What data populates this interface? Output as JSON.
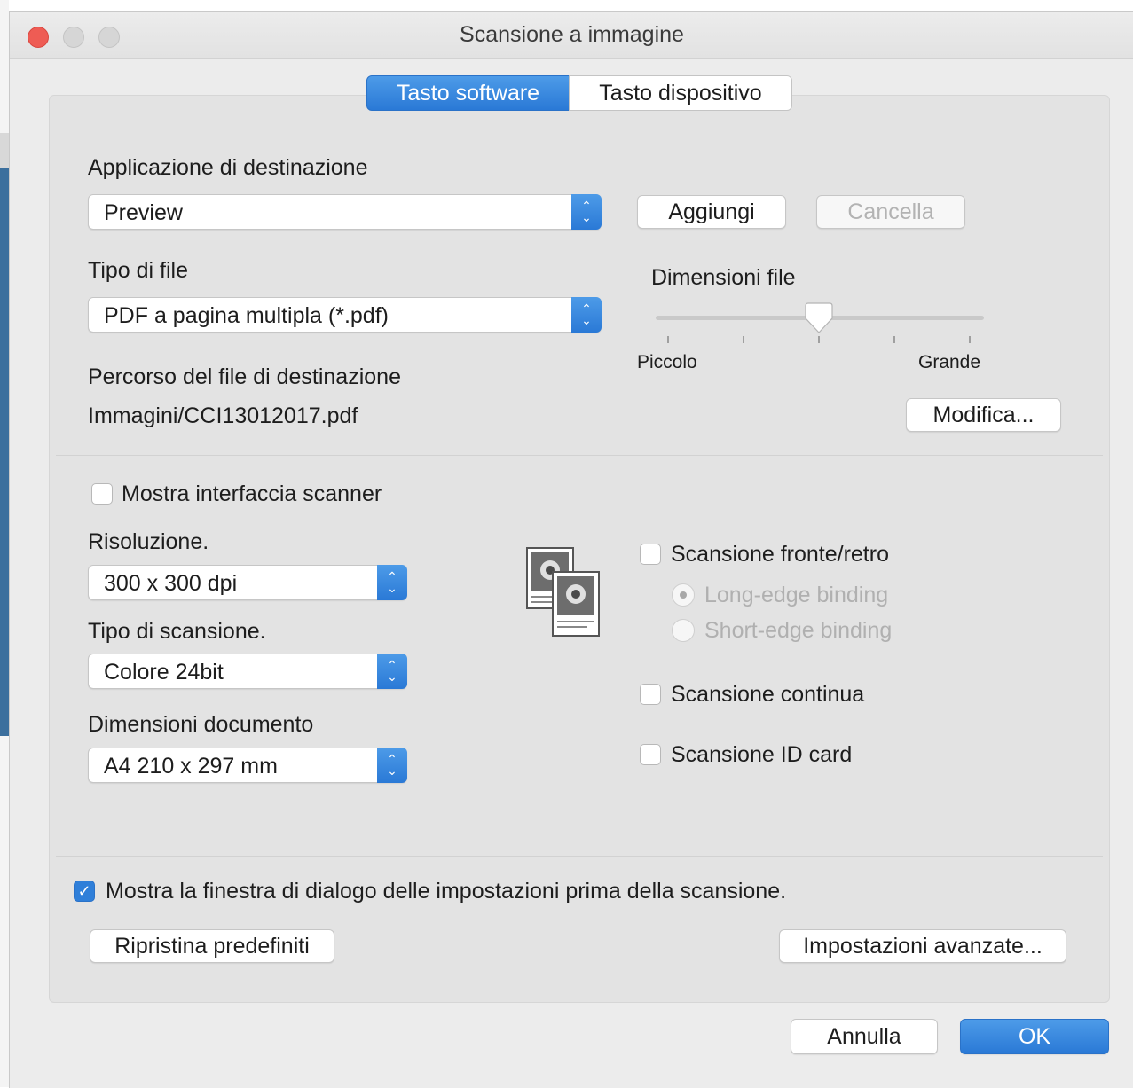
{
  "window": {
    "title": "Scansione a immagine"
  },
  "tabs": [
    {
      "label": "Tasto software",
      "selected": true
    },
    {
      "label": "Tasto dispositivo",
      "selected": false
    }
  ],
  "destination": {
    "label": "Applicazione di destinazione",
    "value": "Preview",
    "add_button": "Aggiungi",
    "delete_button": "Cancella"
  },
  "file_type": {
    "label": "Tipo di file",
    "value": "PDF a pagina multipla (*.pdf)"
  },
  "file_size": {
    "label": "Dimensioni file",
    "min_label": "Piccolo",
    "max_label": "Grande",
    "level": 0.5
  },
  "destination_path": {
    "label": "Percorso del file di destinazione",
    "value": "Immagini/CCI13012017.pdf",
    "modify_button": "Modifica..."
  },
  "scanner_interface": {
    "label": "Mostra interfaccia scanner",
    "checked": false
  },
  "resolution": {
    "label": "Risoluzione.",
    "value": "300 x 300 dpi"
  },
  "scan_type": {
    "label": "Tipo di scansione.",
    "value": "Colore 24bit"
  },
  "doc_size": {
    "label": "Dimensioni documento",
    "value": "A4 210 x 297 mm"
  },
  "duplex": {
    "label": "Scansione fronte/retro",
    "checked": false,
    "long_edge": "Long-edge binding",
    "short_edge": "Short-edge binding"
  },
  "continuous": {
    "label": "Scansione continua",
    "checked": false
  },
  "id_card": {
    "label": "Scansione ID card",
    "checked": false
  },
  "show_dialog": {
    "label": "Mostra la finestra di dialogo delle impostazioni prima della scansione.",
    "checked": true
  },
  "buttons": {
    "reset": "Ripristina predefiniti",
    "advanced": "Impostazioni avanzate...",
    "cancel": "Annulla",
    "ok": "OK"
  },
  "colors": {
    "accent": "#2a79d6",
    "close": "#ee5c54",
    "inactive_light": "#d6d6d6"
  }
}
